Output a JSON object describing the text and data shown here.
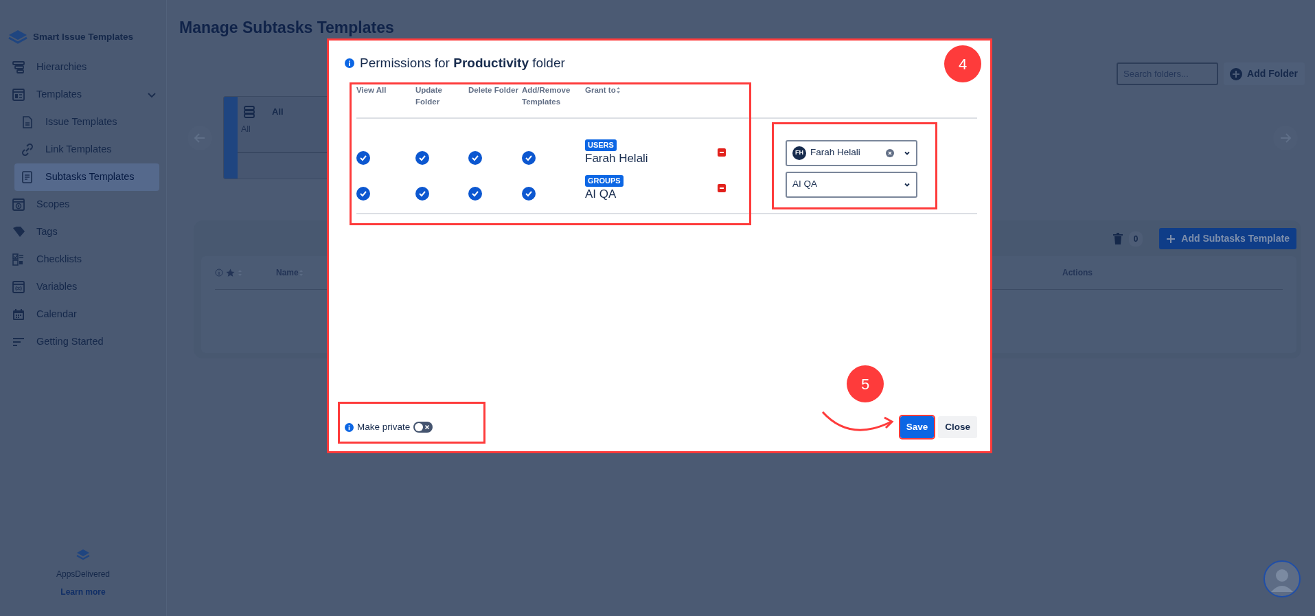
{
  "sidebar": {
    "title": "Smart Issue Templates",
    "items": [
      {
        "label": "Hierarchies",
        "selected": false
      },
      {
        "label": "Templates",
        "selected": false,
        "expanded": true,
        "children": [
          {
            "label": "Issue Templates",
            "selected": false
          },
          {
            "label": "Link Templates",
            "selected": false
          },
          {
            "label": "Subtasks Templates",
            "selected": true
          }
        ]
      },
      {
        "label": "Scopes",
        "selected": false
      },
      {
        "label": "Tags",
        "selected": false
      },
      {
        "label": "Checklists",
        "selected": false
      },
      {
        "label": "Variables",
        "selected": false
      },
      {
        "label": "Calendar",
        "selected": false
      },
      {
        "label": "Getting Started",
        "selected": false
      }
    ],
    "brand": "AppsDelivered",
    "link": "Learn more"
  },
  "page": {
    "title": "Manage Subtasks Templates",
    "search": {
      "placeholder": "Search folders..."
    },
    "add_folder_button": "Add Folder",
    "folders": [
      {
        "title": "All",
        "description": "All",
        "selected": true
      }
    ],
    "table": {
      "trash_count": "0",
      "add_button": "Add Subtasks Template",
      "columns": [
        {
          "label": "Name",
          "sortable": true
        },
        {
          "label": "Actions",
          "sortable": false
        }
      ]
    }
  },
  "modal": {
    "title": "Permissions for **Productivity** folder",
    "highlighted": true,
    "columns": [
      {
        "label": "View All",
        "sortable": false
      },
      {
        "label": "Update Folder",
        "sortable": false
      },
      {
        "label": "Delete Folder",
        "sortable": false
      },
      {
        "label": "Add/Remove Templates",
        "sortable": false
      },
      {
        "label": "Grant to",
        "sortable": true
      }
    ],
    "rows": [
      {
        "group": "USERS",
        "name": "Farah Helali",
        "permissions": [
          true,
          true,
          true,
          true
        ]
      },
      {
        "group": "GROUPS",
        "name": "AI QA",
        "permissions": [
          true,
          true,
          true,
          true
        ]
      }
    ],
    "table_highlighted": true,
    "selects": [
      {
        "value": "Farah Helali",
        "avatar": "FH",
        "clearable": true
      },
      {
        "value": "AI QA",
        "clearable": false
      }
    ],
    "selects_highlighted": true,
    "make_private": {
      "label": "Make private",
      "on": false,
      "highlighted": true
    },
    "buttons": [
      {
        "label": "Save",
        "kind": "primary",
        "highlighted": true
      },
      {
        "label": "Close",
        "kind": "secondary",
        "highlighted": false
      }
    ]
  },
  "annotations": [
    {
      "kind": "marker",
      "label": "4"
    },
    {
      "kind": "marker",
      "label": "5"
    },
    {
      "kind": "arrow"
    }
  ]
}
